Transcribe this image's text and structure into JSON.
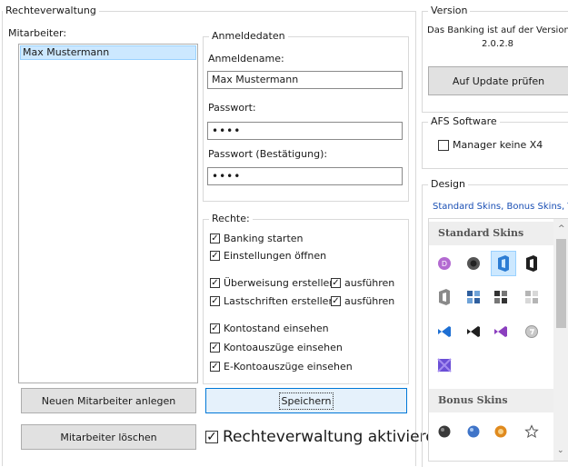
{
  "rights_management": {
    "group_title": "Rechteverwaltung",
    "employees_label": "Mitarbeiter:",
    "employees": [
      "Max Mustermann"
    ],
    "new_employee_button": "Neuen Mitarbeiter anlegen",
    "delete_employee_button": "Mitarbeiter löschen",
    "login_data": {
      "group_title": "Anmeldedaten",
      "login_name_label": "Anmeldename:",
      "login_name_value": "Max Mustermann",
      "password_label": "Passwort:",
      "password_value": "••••",
      "password_confirm_label": "Passwort (Bestätigung):",
      "password_confirm_value": "••••"
    },
    "rights": {
      "group_title": "Rechte:",
      "banking_start": "Banking starten",
      "open_settings": "Einstellungen öffnen",
      "create_transfer": "Überweisung erstellen",
      "execute_transfer": "ausführen",
      "create_direct_debit": "Lastschriften erstellen",
      "execute_direct_debit": "ausführen",
      "view_balance": "Kontostand einsehen",
      "view_statements": "Kontoauszüge einsehen",
      "view_e_statements": "E-Kontoauszüge einsehen"
    },
    "save_button": "Speichern",
    "activate_label": "Rechteverwaltung aktivieren"
  },
  "version": {
    "group_title": "Version",
    "text": "Das Banking ist auf der Version:",
    "number": "2.0.2.8",
    "update_button": "Auf Update prüfen"
  },
  "afs": {
    "group_title": "AFS Software",
    "manager_label": "Manager keine X4"
  },
  "design": {
    "group_title": "Design",
    "link_text": "Standard Skins, Bonus Skins, Th",
    "standard_header": "Standard Skins",
    "bonus_header": "Bonus Skins",
    "icons": [
      "purple-d-icon",
      "dark-d-icon",
      "office-blue-icon",
      "office-black-icon",
      "office-grey-icon",
      "blueprint-icon",
      "dark-grid-icon",
      "light-grid-icon",
      "vs-blue-icon",
      "vs-black-icon",
      "vs-purple-icon",
      "grey-circle-icon",
      "purple-square-icon"
    ],
    "bonus_icons": [
      "black-sphere-icon",
      "blue-sphere-icon",
      "orange-sphere-icon",
      "star-icon"
    ]
  }
}
